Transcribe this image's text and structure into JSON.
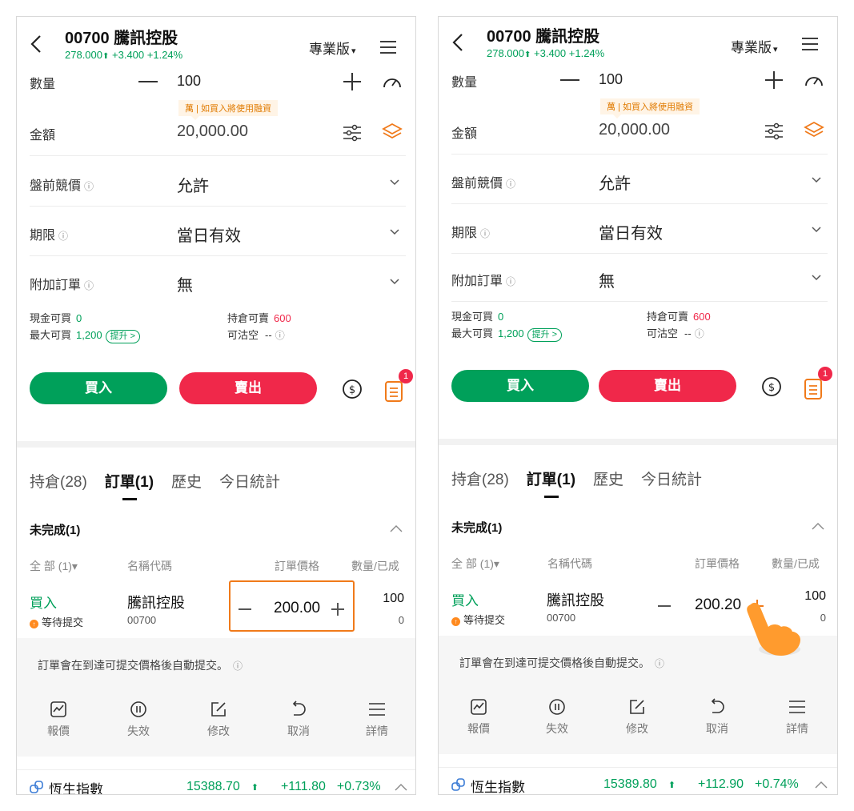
{
  "header": {
    "title": "00700 騰訊控股",
    "price": "278.000",
    "price_arrow": "⬆",
    "change": "+3.400",
    "change_pct": "+1.24%",
    "edition": "專業版",
    "edition_caret": "▾"
  },
  "form": {
    "qty_label": "數量",
    "qty_value": "100",
    "tip": "萬 | 如買入將使用融資",
    "amount_label": "金額",
    "amount_value": "20,000.00",
    "premarket_label": "盤前競價",
    "premarket_value": "允許",
    "term_label": "期限",
    "term_value": "當日有效",
    "attach_label": "附加訂單",
    "attach_value": "無",
    "info_icon": "ⓘ"
  },
  "account": {
    "cash_buy_label": "現金可買",
    "cash_buy_value": "0",
    "max_buy_label": "最大可買",
    "max_buy_value": "1,200",
    "boost_label": "提升 >",
    "pos_sell_label": "持倉可賣",
    "pos_sell_value": "600",
    "short_label": "可沽空",
    "short_value": "--"
  },
  "actions": {
    "buy_label": "買入",
    "sell_label": "賣出",
    "badge": "1"
  },
  "tabs": [
    {
      "label": "持倉(28)"
    },
    {
      "label": "訂單(1)"
    },
    {
      "label": "歷史"
    },
    {
      "label": "今日統計"
    }
  ],
  "orders": {
    "section_title": "未完成(1)",
    "col_filter": "全 部 (1)▾",
    "col_name": "名稱代碼",
    "col_price": "訂單價格",
    "col_qty": "數量/已成",
    "side": "買入",
    "status": "等待提交",
    "status_icon": "↑",
    "name": "騰訊控股",
    "code": "00700",
    "qty": "100",
    "filled": "0",
    "note": "訂單會在到達可提交價格後自動提交。"
  },
  "order_actions": [
    {
      "label": "報價",
      "icon": "chart-icon"
    },
    {
      "label": "失效",
      "icon": "pause-icon"
    },
    {
      "label": "修改",
      "icon": "edit-icon"
    },
    {
      "label": "取消",
      "icon": "undo-icon"
    },
    {
      "label": "詳情",
      "icon": "list-icon"
    }
  ],
  "left": {
    "order_price": "200.00",
    "index_name": "恆生指數",
    "index_value": "15388.70",
    "index_arrow": "⬆",
    "index_change": "+111.80",
    "index_pct": "+0.73%"
  },
  "right": {
    "order_price": "200.20",
    "index_name": "恆生指數",
    "index_value": "15389.80",
    "index_arrow": "⬆",
    "index_change": "+112.90",
    "index_pct": "+0.74%"
  },
  "colors": {
    "green": "#00a05a",
    "red": "#f0284a",
    "orange": "#f07a1a"
  }
}
